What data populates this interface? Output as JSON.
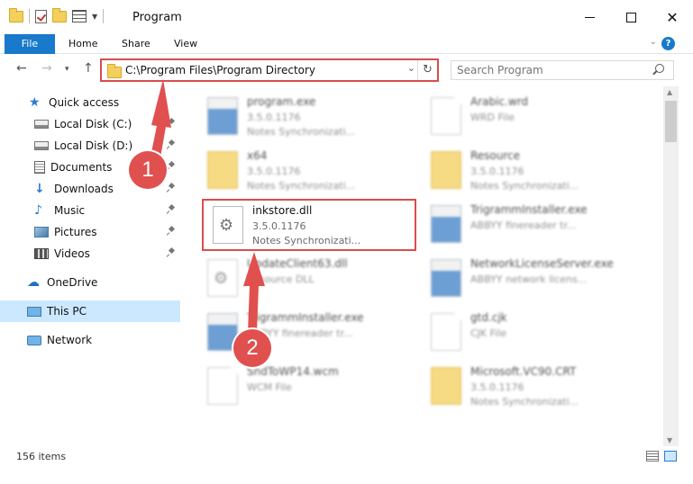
{
  "window": {
    "title": "Program"
  },
  "ribbon": {
    "file": "File",
    "home": "Home",
    "share": "Share",
    "view": "View"
  },
  "address": {
    "path": "C:\\Program Files\\Program Directory"
  },
  "search": {
    "placeholder": "Search Program"
  },
  "sidebar": {
    "items": [
      {
        "label": "Quick access",
        "icon": "star-icon"
      },
      {
        "label": "Local Disk (C:)",
        "icon": "disk-icon"
      },
      {
        "label": "Local Disk (D:)",
        "icon": "disk-icon"
      },
      {
        "label": "Documents",
        "icon": "documents-icon"
      },
      {
        "label": "Downloads",
        "icon": "downloads-icon"
      },
      {
        "label": "Music",
        "icon": "music-icon"
      },
      {
        "label": "Pictures",
        "icon": "pictures-icon"
      },
      {
        "label": "Videos",
        "icon": "videos-icon"
      },
      {
        "label": "OneDrive",
        "icon": "cloud-icon"
      },
      {
        "label": "This PC",
        "icon": "computer-icon"
      },
      {
        "label": "Network",
        "icon": "network-icon"
      }
    ]
  },
  "files": [
    {
      "name": "program.exe",
      "version": "3.5.0.1176",
      "desc": "Notes Synchronizati..."
    },
    {
      "name": "Arabic.wrd",
      "version": "WRD File",
      "desc": ""
    },
    {
      "name": "x64",
      "version": "3.5.0.1176",
      "desc": "Notes Synchronizati..."
    },
    {
      "name": "Resource",
      "version": "3.5.0.1176",
      "desc": "Notes Synchronizati..."
    },
    {
      "name": "inkstore.dll",
      "version": "3.5.0.1176",
      "desc": "Notes Synchronizati..."
    },
    {
      "name": "TrigrammInstaller.exe",
      "version": "ABBYY finereader tr...",
      "desc": ""
    },
    {
      "name": "UpdateClient63.dll",
      "version": "Resource DLL",
      "desc": ""
    },
    {
      "name": "NetworkLicenseServer.exe",
      "version": "ABBYY network licens...",
      "desc": ""
    },
    {
      "name": "TrigrammInstaller.exe",
      "version": "ABBYY finereader tr...",
      "desc": ""
    },
    {
      "name": "gtd.cjk",
      "version": "CJK File",
      "desc": ""
    },
    {
      "name": "SndToWP14.wcm",
      "version": "WCM File",
      "desc": ""
    },
    {
      "name": "Microsoft.VC90.CRT",
      "version": "3.5.0.1176",
      "desc": "Notes Synchronizati..."
    }
  ],
  "status": {
    "count": "156 items"
  },
  "annotations": {
    "step1": "1",
    "step2": "2"
  },
  "colors": {
    "accent": "#1979ca",
    "annotation": "#e0504f",
    "selected": "#cce8ff"
  }
}
